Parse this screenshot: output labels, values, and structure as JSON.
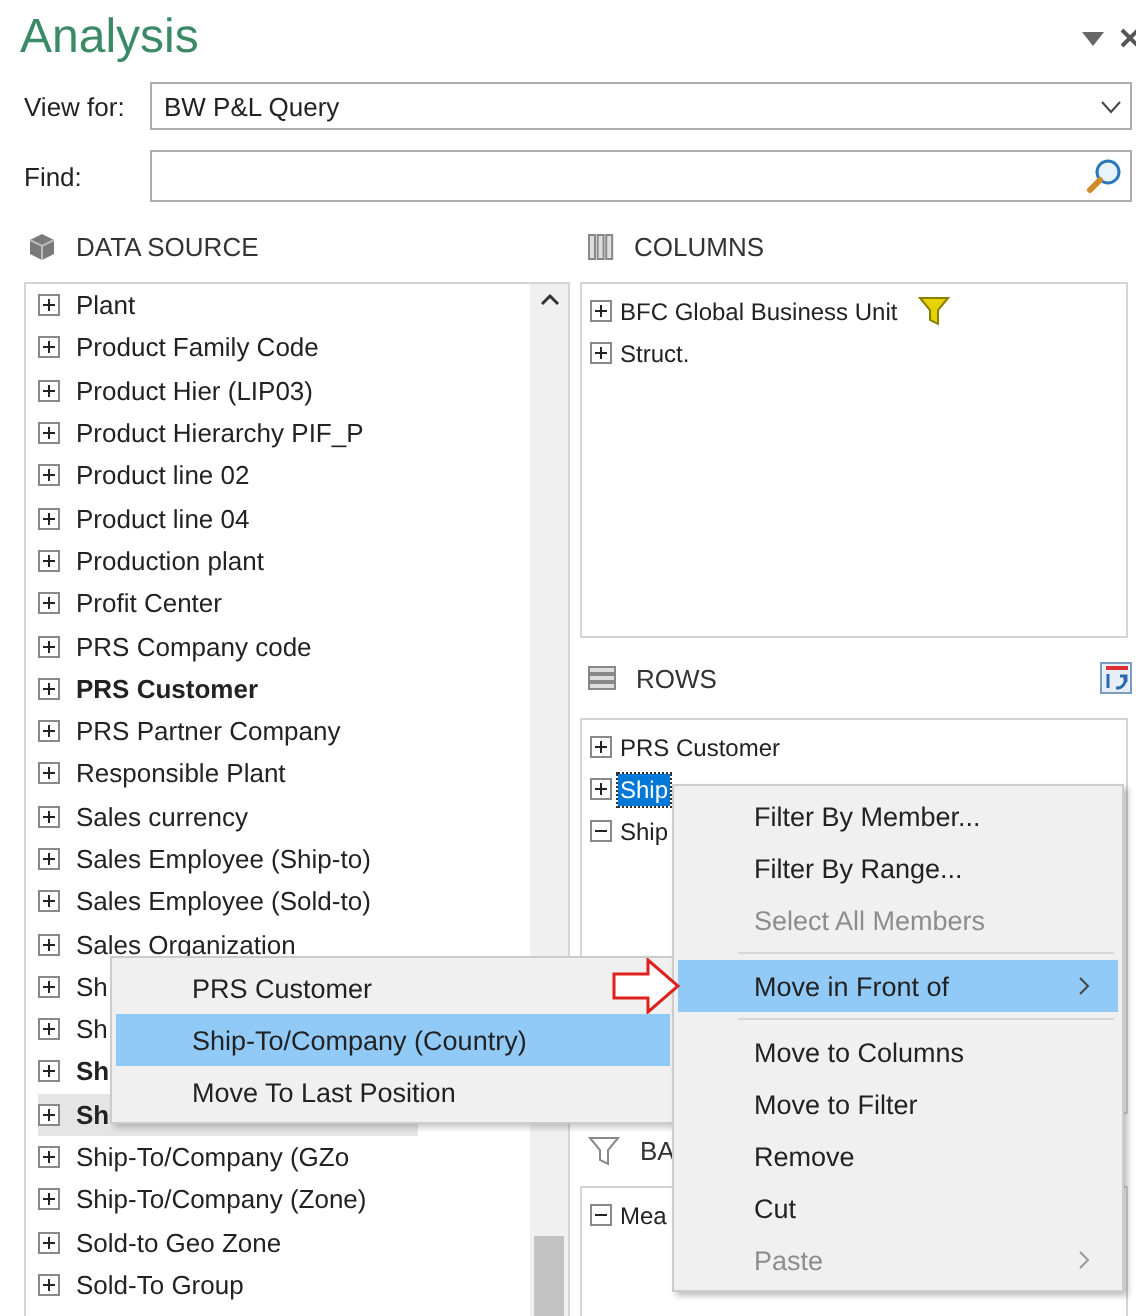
{
  "panel": {
    "title": "Analysis"
  },
  "view_for": {
    "label": "View for:",
    "value": "BW P&L Query"
  },
  "find": {
    "label": "Find:"
  },
  "data_source": {
    "title": "DATA SOURCE",
    "items": [
      {
        "label": "Plant",
        "bold": false,
        "highlighted": false
      },
      {
        "label": "Product Family Code",
        "bold": false,
        "highlighted": false
      },
      {
        "label": "Product Hier (LIP03)",
        "bold": false,
        "highlighted": false
      },
      {
        "label": "Product Hierarchy PIF_P",
        "bold": false,
        "highlighted": false
      },
      {
        "label": "Product line 02",
        "bold": false,
        "highlighted": false
      },
      {
        "label": "Product line 04",
        "bold": false,
        "highlighted": false
      },
      {
        "label": "Production plant",
        "bold": false,
        "highlighted": false
      },
      {
        "label": "Profit Center",
        "bold": false,
        "highlighted": false
      },
      {
        "label": "PRS Company code",
        "bold": false,
        "highlighted": false
      },
      {
        "label": "PRS Customer",
        "bold": true,
        "highlighted": false
      },
      {
        "label": "PRS Partner Company",
        "bold": false,
        "highlighted": false
      },
      {
        "label": "Responsible Plant",
        "bold": false,
        "highlighted": false
      },
      {
        "label": "Sales currency",
        "bold": false,
        "highlighted": false
      },
      {
        "label": "Sales Employee (Ship-to)",
        "bold": false,
        "highlighted": false
      },
      {
        "label": "Sales Employee (Sold-to)",
        "bold": false,
        "highlighted": false
      },
      {
        "label": "Sales Organization",
        "bold": false,
        "highlighted": false
      },
      {
        "label": "Sh",
        "bold": false,
        "highlighted": false
      },
      {
        "label": "Sh",
        "bold": false,
        "highlighted": false
      },
      {
        "label": "Sh",
        "bold": true,
        "highlighted": false
      },
      {
        "label": "Sh",
        "bold": true,
        "highlighted": true
      },
      {
        "label": "Ship-To/Company (GZo",
        "bold": false,
        "highlighted": false
      },
      {
        "label": "Ship-To/Company (Zone)",
        "bold": false,
        "highlighted": false
      },
      {
        "label": "Sold-to Geo Zone",
        "bold": false,
        "highlighted": false
      },
      {
        "label": "Sold-To Group",
        "bold": false,
        "highlighted": false
      }
    ]
  },
  "columns": {
    "title": "COLUMNS",
    "items": [
      {
        "label": "BFC Global Business Unit",
        "expanded": false,
        "filtered": true
      },
      {
        "label": "Struct.",
        "expanded": false,
        "filtered": false
      }
    ]
  },
  "rows": {
    "title": "ROWS",
    "items": [
      {
        "label": "PRS Customer",
        "expanded": false,
        "selected": false
      },
      {
        "label": "Ship",
        "expanded": false,
        "selected": true
      },
      {
        "label": "Ship",
        "expanded": true,
        "selected": false
      }
    ]
  },
  "filter": {
    "title": "BA",
    "items": [
      {
        "label": "Mea",
        "expanded": true
      }
    ]
  },
  "context_menu": {
    "items": [
      {
        "kind": "item",
        "label": "Filter By Member...",
        "disabled": false,
        "selected": false,
        "submenu": false
      },
      {
        "kind": "item",
        "label": "Filter By Range...",
        "disabled": false,
        "selected": false,
        "submenu": false
      },
      {
        "kind": "item",
        "label": "Select All Members",
        "disabled": true,
        "selected": false,
        "submenu": false
      },
      {
        "kind": "separator"
      },
      {
        "kind": "item",
        "label": "Move in Front of",
        "disabled": false,
        "selected": true,
        "submenu": true
      },
      {
        "kind": "separator"
      },
      {
        "kind": "item",
        "label": "Move to Columns",
        "disabled": false,
        "selected": false,
        "submenu": false
      },
      {
        "kind": "item",
        "label": "Move to Filter",
        "disabled": false,
        "selected": false,
        "submenu": false
      },
      {
        "kind": "item",
        "label": "Remove",
        "disabled": false,
        "selected": false,
        "submenu": false
      },
      {
        "kind": "item",
        "label": "Cut",
        "disabled": false,
        "selected": false,
        "submenu": false
      },
      {
        "kind": "item",
        "label": "Paste",
        "disabled": true,
        "selected": false,
        "submenu": true
      }
    ]
  },
  "submenu": {
    "items": [
      {
        "label": "PRS Customer",
        "selected": false
      },
      {
        "label": "Ship-To/Company (Country)",
        "selected": true
      },
      {
        "label": "Move To Last Position",
        "selected": false
      }
    ]
  }
}
